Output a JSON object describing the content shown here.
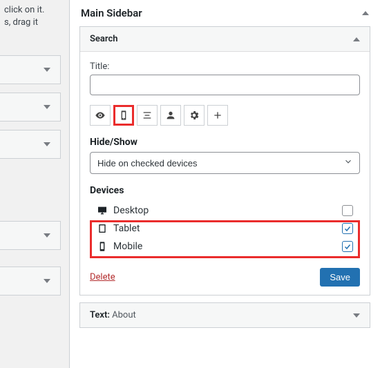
{
  "left": {
    "hint_line1": "click on it.",
    "hint_line2": "s, drag it"
  },
  "panel": {
    "title": "Main Sidebar"
  },
  "widget": {
    "title": "Search",
    "title_field_label": "Title:",
    "title_field_value": "",
    "toolbar": {
      "visibility_icon": "eye-icon",
      "device_icon": "mobile-icon",
      "align_icon": "align-icon",
      "user_icon": "user-icon",
      "settings_icon": "gear-icon",
      "add_icon": "plus-icon"
    },
    "hideshow": {
      "label": "Hide/Show",
      "selected": "Hide on checked devices"
    },
    "devices": {
      "label": "Devices",
      "rows": [
        {
          "name": "Desktop",
          "checked": false
        },
        {
          "name": "Tablet",
          "checked": true
        },
        {
          "name": "Mobile",
          "checked": true
        }
      ]
    },
    "delete_label": "Delete",
    "save_label": "Save"
  },
  "collapsed_widget": {
    "name": "Text",
    "instance": "About"
  }
}
